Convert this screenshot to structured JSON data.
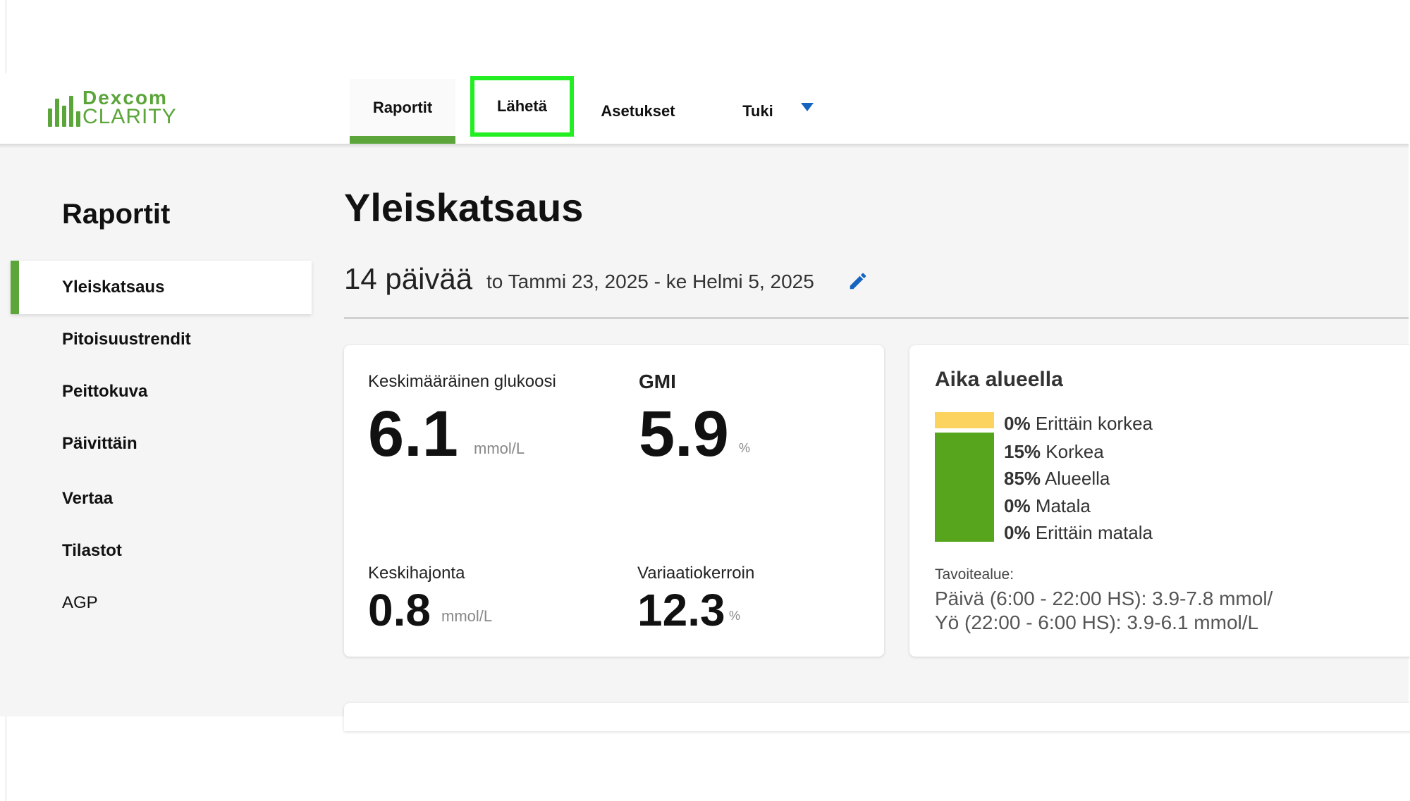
{
  "header": {
    "logo_top": "Dexcom",
    "logo_bottom": "CLARITY",
    "tabs": [
      {
        "label": "Raportit"
      },
      {
        "label": "Lähetä"
      },
      {
        "label": "Asetukset"
      },
      {
        "label": "Tuki"
      }
    ]
  },
  "sidebar": {
    "title": "Raportit",
    "items": [
      {
        "label": "Yleiskatsaus"
      },
      {
        "label": "Pitoisuustrendit"
      },
      {
        "label": "Peittokuva"
      },
      {
        "label": "Päivittäin"
      },
      {
        "label": "Vertaa"
      },
      {
        "label": "Tilastot"
      },
      {
        "label": "AGP"
      }
    ]
  },
  "main": {
    "title": "Yleiskatsaus",
    "period_days": "14 päivää",
    "period_range": "to Tammi 23, 2025 - ke Helmi 5, 2025",
    "stats": {
      "avg_label": "Keskimääräinen glukoosi",
      "avg_value": "6.1",
      "avg_unit": "mmol/L",
      "gmi_label": "GMI",
      "gmi_value": "5.9",
      "gmi_unit": "%",
      "sd_label": "Keskihajonta",
      "sd_value": "0.8",
      "sd_unit": "mmol/L",
      "cv_label": "Variaatiokerroin",
      "cv_value": "12.3",
      "cv_unit": "%"
    },
    "time_in_range": {
      "title": "Aika alueella",
      "rows": [
        {
          "pct": "0%",
          "label": "Erittäin korkea"
        },
        {
          "pct": "15%",
          "label": "Korkea"
        },
        {
          "pct": "85%",
          "label": "Alueella"
        },
        {
          "pct": "0%",
          "label": "Matala"
        },
        {
          "pct": "0%",
          "label": "Erittäin matala"
        }
      ],
      "target_label": "Tavoitealue:",
      "target_day": "Päivä (6:00 - 22:00 HS): 3.9-7.8 mmol/",
      "target_night": "Yö (22:00 - 6:00 HS): 3.9-6.1 mmol/L"
    }
  },
  "colors": {
    "brand_green": "#5ba53a",
    "in_range": "#57a51d",
    "high": "#fcd35e",
    "highlight_box": "#22ee22",
    "link_blue": "#1565c0"
  }
}
